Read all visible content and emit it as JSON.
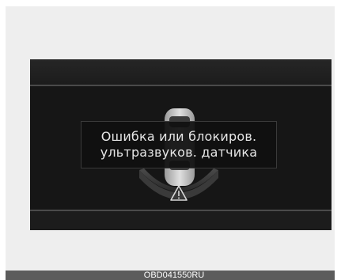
{
  "message": {
    "line1": "Ошибка или блокиров.",
    "line2": "ультразвуков. датчика"
  },
  "icons": {
    "car": "car-top-view-icon",
    "sensor_zone": "sensor-zone-icon",
    "warning": "warning-triangle-icon"
  },
  "caption": "OBD041550RU",
  "colors": {
    "screen_background": "#161616",
    "message_text": "#e6e6e6",
    "caption_bar": "#5c5c5c"
  }
}
